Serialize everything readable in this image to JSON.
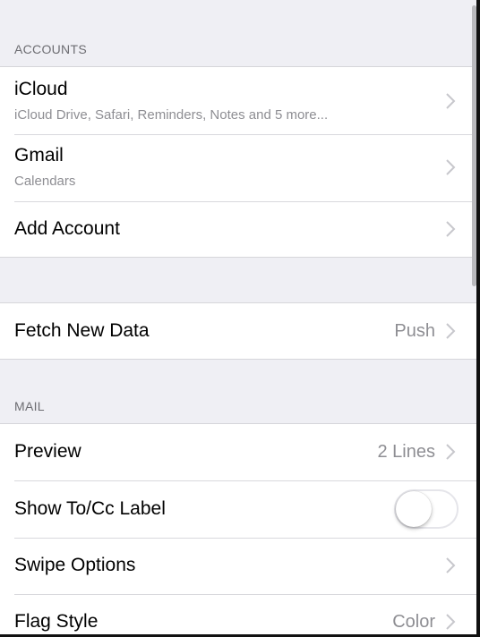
{
  "accounts_section": {
    "header": "ACCOUNTS",
    "items": [
      {
        "title": "iCloud",
        "subtitle": "iCloud Drive, Safari, Reminders, Notes and 5 more..."
      },
      {
        "title": "Gmail",
        "subtitle": "Calendars"
      },
      {
        "title": "Add Account"
      }
    ]
  },
  "fetch_section": {
    "title": "Fetch New Data",
    "value": "Push"
  },
  "mail_section": {
    "header": "MAIL",
    "preview": {
      "title": "Preview",
      "value": "2 Lines"
    },
    "show_to_cc": {
      "title": "Show To/Cc Label",
      "toggle_on": false
    },
    "swipe_options": {
      "title": "Swipe Options"
    },
    "flag_style": {
      "title": "Flag Style",
      "value": "Color"
    }
  },
  "icons": {
    "chevron": "chevron-right-icon",
    "toggle": "switch-toggle"
  },
  "colors": {
    "background": "#efeff4",
    "cell": "#ffffff",
    "secondary_text": "#8e8e93",
    "header_text": "#6d6d72",
    "separator": "#d9d9dd",
    "toggle_border": "#e5e5ea"
  }
}
